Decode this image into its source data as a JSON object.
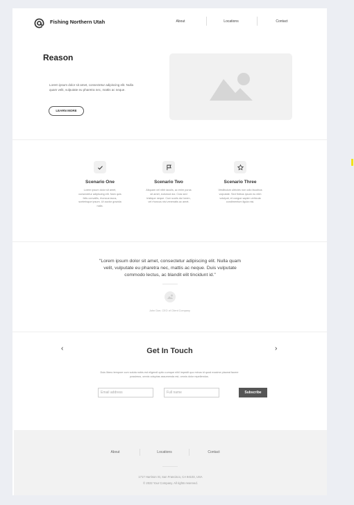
{
  "header": {
    "brand": "Fishing Northern Utah",
    "nav": [
      "About",
      "Locations",
      "Contact"
    ]
  },
  "hero": {
    "title": "Reason",
    "text": "Lorem ipsum dolor sit amet, consectetur adipiscing elit. Nulla quam velit, vulputate eu pharetra nec, mattis ac neque.",
    "button": "LEARN MORE"
  },
  "features": [
    {
      "icon": "check-icon",
      "title": "Scenario One",
      "text": "Lorem ipsum dolor sit amet, consectetur adipiscing elit. Nam quis felis convallis, rhoncus lacus, scelerisque ipsum. Ut auctor gravida nulla."
    },
    {
      "icon": "flag-icon",
      "title": "Scenario Two",
      "text": "Aliquam vel nibh iaculis, ac enim purus sit amet, euismod dui. Cras sed tristique neque. Cum sociis dui lorem, vel rhoncus nisi venenatis ac amet."
    },
    {
      "icon": "star-icon",
      "title": "Scenario Three",
      "text": "Vestibulum ultricies non odio faucibus vulputate. Sed finibus ipsum eu nibh volutpat, et congue sapien vehicula condimentum ligula nisi."
    }
  ],
  "quote": {
    "text": "\"Lorem ipsum dolor sit amet, consectetur adipiscing elit. Nulla quam velit, vulputate eu pharetra nec, mattis ac neque. Duis vulputate commodo lectus, ac blandit elit tincidunt id.\"",
    "author": "John Doe, CEO of Client Company"
  },
  "contact": {
    "title": "Get In Touch",
    "prev_arrow": "‹",
    "next_arrow": "›",
    "text": "Duis libero tempore cum soluta nobis est eligendi optio cumque nihil impedit quo minus id quod maxime placeat facere possimus, omnis voluptas assumenda est, omnis dolor repellendus.",
    "email_placeholder": "Email address",
    "name_placeholder": "Full name",
    "subscribe": "Subscribe"
  },
  "footer": {
    "nav": [
      "About",
      "Locations",
      "Contact"
    ],
    "address": "1717 Harrison St, San Francisco, CA 94103, USA",
    "copyright": "© 2022 Your Company. All rights reserved."
  }
}
